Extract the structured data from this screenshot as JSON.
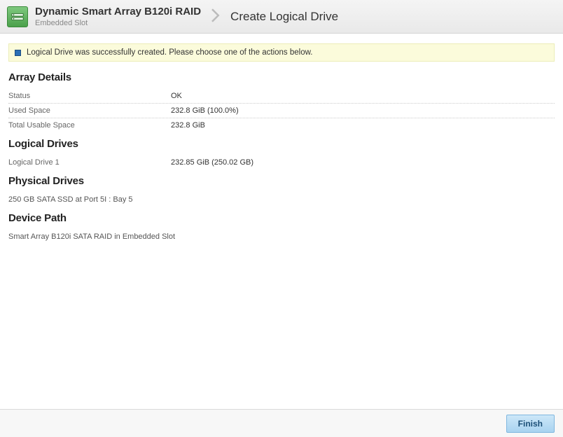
{
  "breadcrumb": {
    "controller_title": "Dynamic Smart Array B120i RAID",
    "controller_sub": "Embedded Slot",
    "page_title": "Create Logical Drive"
  },
  "notice": {
    "text": "Logical Drive was successfully created. Please choose one of the actions below."
  },
  "sections": {
    "array_details": {
      "heading": "Array Details",
      "rows": [
        {
          "key": "Status",
          "val": "OK"
        },
        {
          "key": "Used Space",
          "val": "232.8 GiB (100.0%)"
        },
        {
          "key": "Total Usable Space",
          "val": "232.8 GiB"
        }
      ]
    },
    "logical_drives": {
      "heading": "Logical Drives",
      "rows": [
        {
          "key": "Logical Drive 1",
          "val": "232.85 GiB (250.02 GB)"
        }
      ]
    },
    "physical_drives": {
      "heading": "Physical Drives",
      "line": "250 GB SATA SSD at Port 5I : Bay 5"
    },
    "device_path": {
      "heading": "Device Path",
      "line": "Smart Array B120i SATA RAID in Embedded Slot"
    }
  },
  "footer": {
    "finish_label": "Finish"
  }
}
